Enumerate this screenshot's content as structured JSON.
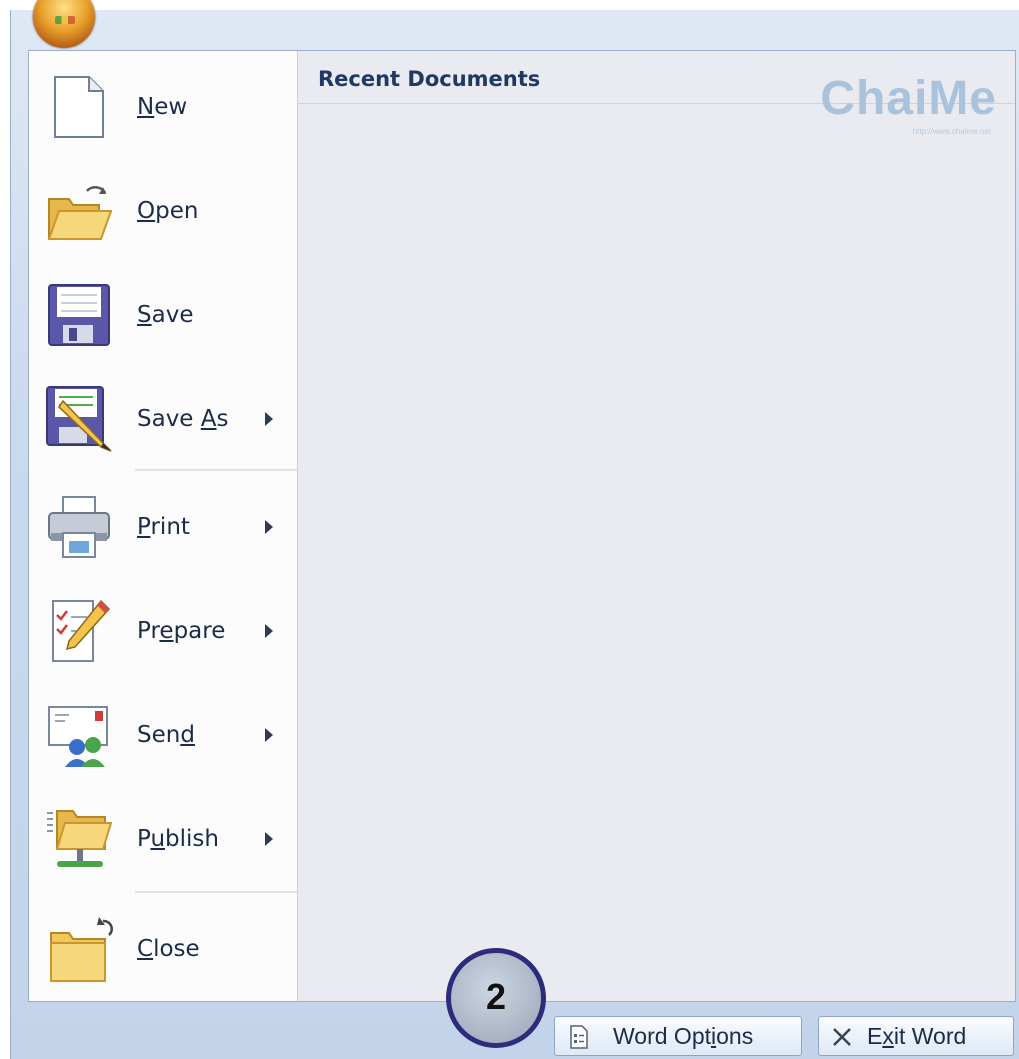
{
  "menu": {
    "items": [
      {
        "name": "new",
        "before": "",
        "key": "N",
        "after": "ew",
        "has_submenu": false,
        "icon": "new-document-icon"
      },
      {
        "name": "open",
        "before": "",
        "key": "O",
        "after": "pen",
        "has_submenu": false,
        "icon": "open-folder-icon"
      },
      {
        "name": "save",
        "before": "",
        "key": "S",
        "after": "ave",
        "has_submenu": false,
        "icon": "save-disk-icon"
      },
      {
        "name": "save-as",
        "before": "Save ",
        "key": "A",
        "after": "s",
        "has_submenu": true,
        "icon": "save-as-icon"
      },
      {
        "name": "print",
        "before": "",
        "key": "P",
        "after": "rint",
        "has_submenu": true,
        "icon": "printer-icon"
      },
      {
        "name": "prepare",
        "before": "Pr",
        "key": "e",
        "after": "pare",
        "has_submenu": true,
        "icon": "prepare-checklist-icon"
      },
      {
        "name": "send",
        "before": "Sen",
        "key": "d",
        "after": "",
        "has_submenu": true,
        "icon": "send-email-icon"
      },
      {
        "name": "publish",
        "before": "P",
        "key": "u",
        "after": "blish",
        "has_submenu": true,
        "icon": "publish-folder-icon"
      },
      {
        "name": "close",
        "before": "",
        "key": "C",
        "after": "lose",
        "has_submenu": false,
        "icon": "close-folder-icon"
      }
    ]
  },
  "recent": {
    "title": "Recent Documents"
  },
  "watermark": {
    "text": "ChaiMe",
    "sub": "http://www.chaime.net"
  },
  "buttons": {
    "word_options": {
      "before": "Word Opt",
      "key": "i",
      "after": "ons"
    },
    "exit_word": {
      "before": "E",
      "key": "x",
      "after": "it Word"
    }
  },
  "callout": {
    "number": "2"
  },
  "colors": {
    "frame": "#c9d9ee",
    "right_pane": "#e9ebf0",
    "text": "#1b2c4a",
    "heading": "#1f3864",
    "callout_border": "#2d2c7a"
  }
}
